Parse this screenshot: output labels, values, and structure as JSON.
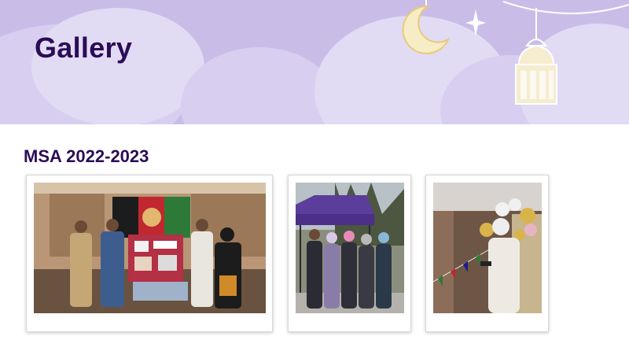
{
  "header": {
    "title": "Gallery",
    "colors": {
      "banner": "#c9bde8",
      "title": "#2a0d57",
      "ornament": "#e8c97a"
    }
  },
  "section": {
    "title": "MSA 2022-2023"
  },
  "photos": [
    {
      "name": "booth-photo",
      "subject": "students standing in front of a flag display booth"
    },
    {
      "name": "tent-photo",
      "subject": "group of students outdoors under a purple tent"
    },
    {
      "name": "speaker-photo",
      "subject": "speaker holding a microphone beside balloons and flags"
    }
  ]
}
